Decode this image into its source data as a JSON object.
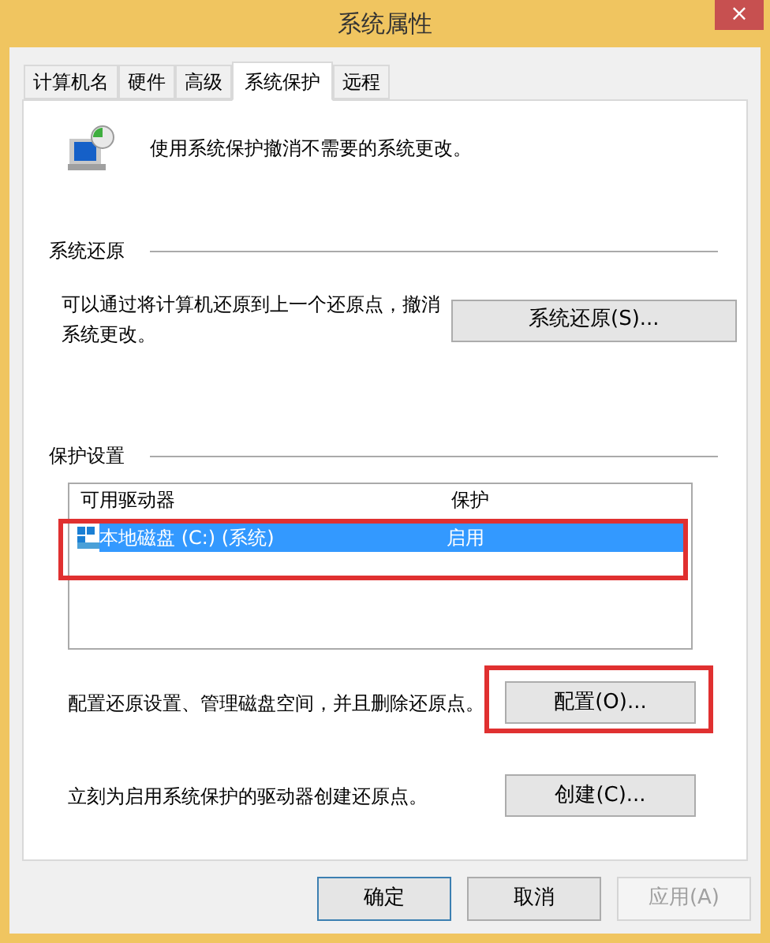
{
  "window": {
    "title": "系统属性",
    "close": "×"
  },
  "tabs": [
    {
      "label": "计算机名",
      "selected": false
    },
    {
      "label": "硬件",
      "selected": false
    },
    {
      "label": "高级",
      "selected": false
    },
    {
      "label": "系统保护",
      "selected": true
    },
    {
      "label": "远程",
      "selected": false
    }
  ],
  "intro": "使用系统保护撤消不需要的系统更改。",
  "restore": {
    "heading": "系统还原",
    "text": "可以通过将计算机还原到上一个还原点，撤消系统更改。",
    "button": "系统还原(S)..."
  },
  "protection": {
    "heading": "保护设置",
    "columns": [
      "可用驱动器",
      "保护"
    ],
    "rows": [
      {
        "drive": "本地磁盘 (C:) (系统)",
        "status": "启用",
        "selected": true,
        "highlighted": true
      }
    ],
    "configure": {
      "text": "配置还原设置、管理磁盘空间，并且删除还原点。",
      "button": "配置(O)...",
      "highlighted": true
    },
    "create": {
      "text": "立刻为启用系统保护的驱动器创建还原点。",
      "button": "创建(C)..."
    }
  },
  "buttons": [
    {
      "label": "确定",
      "disabled": false,
      "default": true
    },
    {
      "label": "取消",
      "disabled": false,
      "default": false
    },
    {
      "label": "应用(A)",
      "disabled": true,
      "default": false
    }
  ]
}
